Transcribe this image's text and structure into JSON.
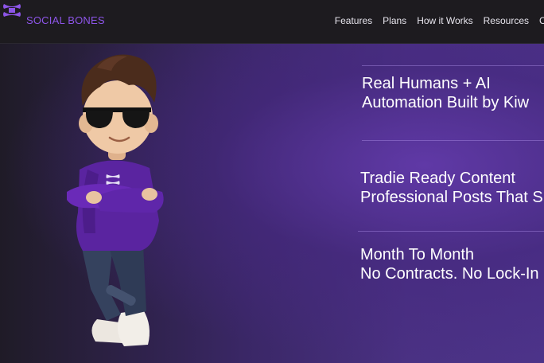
{
  "header": {
    "brand": "SOCIAL BONES",
    "nav": [
      "Features",
      "Plans",
      "How it Works",
      "Resources",
      "C"
    ]
  },
  "features": [
    {
      "line1": "Real Humans + AI",
      "line2": "Automation Built by Kiw"
    },
    {
      "line1": "Tradie Ready Content",
      "line2": "Professional Posts That S"
    },
    {
      "line1": "Month To Month",
      "line2": "No Contracts. No Lock-In"
    }
  ],
  "colors": {
    "accent": "#8d55e8",
    "hero": "#4a3183",
    "topbar": "#1d1b1f"
  },
  "icons": {
    "logo": "social-bones-logo-icon",
    "mascot": "mascot-illustration"
  }
}
